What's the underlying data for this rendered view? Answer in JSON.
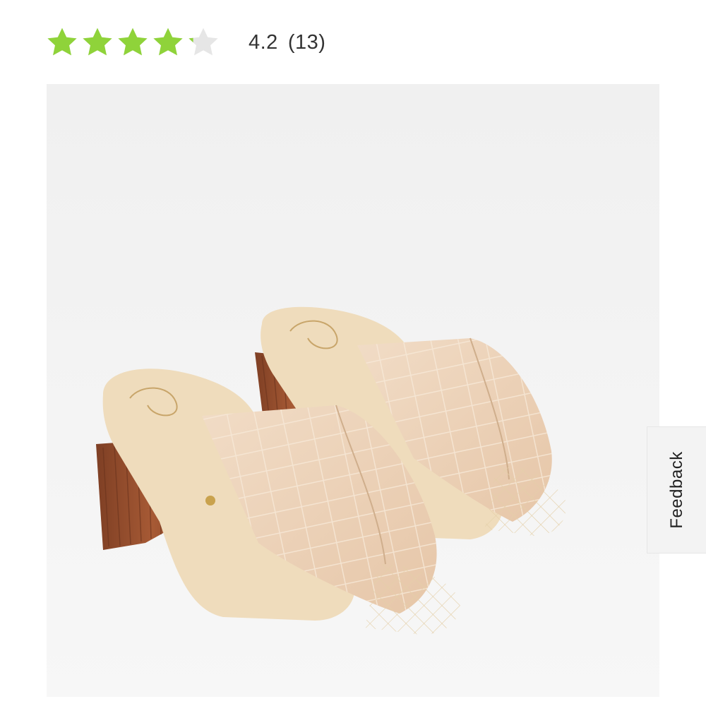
{
  "rating": {
    "value_text": "4.2",
    "count_text": "(13)",
    "score": 4.2,
    "max": 5,
    "star_color": "#8fd33a",
    "empty_star_color": "#e6e6e6"
  },
  "product": {
    "image_icon": "mule-sandal-pair-image",
    "colors": {
      "background": "#f2f2f2",
      "leather": "#ecd2b8",
      "insole": "#f0dcbc",
      "heel": "#9a4f2f"
    }
  },
  "feedback": {
    "label": "Feedback"
  }
}
